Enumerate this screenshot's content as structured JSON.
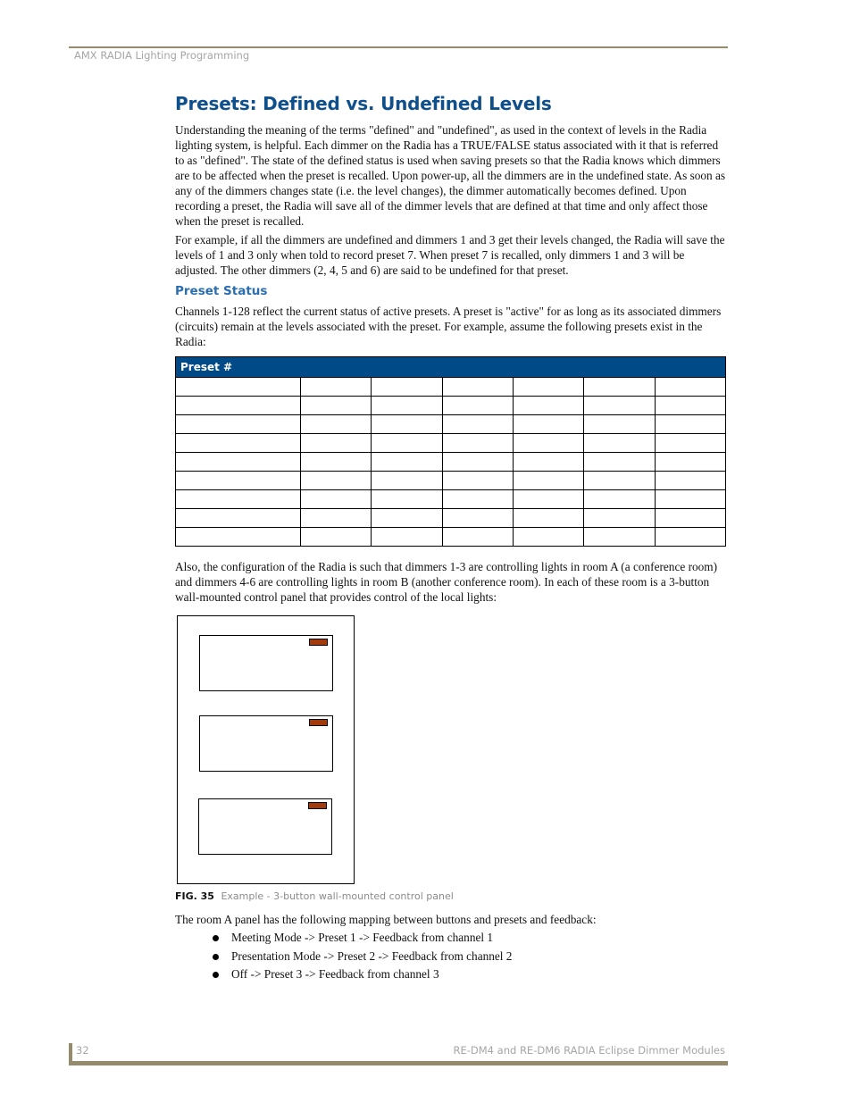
{
  "header": {
    "running_title": "AMX RADIA Lighting Programming"
  },
  "section": {
    "title": "Presets: Defined vs. Undefined Levels",
    "paragraphs": [
      "Understanding the meaning of the terms \"defined\" and \"undefined\", as used in the context of levels in the Radia lighting system, is helpful. Each dimmer on the Radia has a TRUE/FALSE status associated with it that is referred to as \"defined\". The state of the defined status is used when saving presets so that the Radia knows which dimmers are to be affected when the preset is recalled. Upon power-up, all the dimmers are in the undefined state. As soon as any of the dimmers changes state (i.e. the level changes), the dimmer automatically becomes defined. Upon recording a preset, the Radia will save all of the dimmer levels that are defined at that time and only affect those when the preset is recalled.",
      "For example, if all the dimmers are undefined and dimmers 1 and 3 get their levels changed, the Radia will save the levels of 1 and 3 only when told to record preset 7. When preset 7 is recalled, only dimmers 1 and 3 will be adjusted. The other dimmers (2, 4, 5 and 6) are said to be undefined for that preset."
    ]
  },
  "subsection": {
    "title": "Preset Status",
    "paragraphs": [
      "Channels 1-128 reflect the current status of active presets. A preset is \"active\" for as long as its associated dimmers (circuits) remain at the levels associated with the preset. For example, assume the following presets exist in the Radia:",
      "Also, the configuration of the Radia is such that dimmers 1-3 are controlling lights in room A (a conference room) and dimmers 4-6 are controlling lights in room B (another conference room). In each of these room is a 3-button wall-mounted control panel that provides control of the local lights:"
    ]
  },
  "preset_table": {
    "header": "Preset #",
    "rows": [
      [
        "",
        "",
        "",
        "",
        "",
        "",
        ""
      ],
      [
        "",
        "",
        "",
        "",
        "",
        "",
        ""
      ],
      [
        "",
        "",
        "",
        "",
        "",
        "",
        ""
      ],
      [
        "",
        "",
        "",
        "",
        "",
        "",
        ""
      ],
      [
        "",
        "",
        "",
        "",
        "",
        "",
        ""
      ],
      [
        "",
        "",
        "",
        "",
        "",
        "",
        ""
      ],
      [
        "",
        "",
        "",
        "",
        "",
        "",
        ""
      ],
      [
        "",
        "",
        "",
        "",
        "",
        "",
        ""
      ],
      [
        "",
        "",
        "",
        "",
        "",
        "",
        ""
      ]
    ]
  },
  "figure": {
    "label": "FIG. 35",
    "caption": "Example - 3-button wall-mounted control panel",
    "buttons": 3,
    "led_color": "#a33a0c"
  },
  "mapping": {
    "intro": "The room A panel has the following mapping between buttons and presets and feedback:",
    "items": [
      "Meeting Mode -> Preset 1 -> Feedback from channel 1",
      "Presentation Mode -> Preset 2 -> Feedback from channel 2",
      "Off -> Preset 3 -> Feedback from channel 3"
    ]
  },
  "footer": {
    "page_number": "32",
    "document_title": "RE-DM4 and RE-DM6 RADIA Eclipse Dimmer Modules"
  },
  "colors": {
    "heading_blue": "#0e4f8c",
    "subheading_blue": "#2a6db0",
    "table_header_bg": "#004a87",
    "rule_tan": "#958a6c"
  }
}
